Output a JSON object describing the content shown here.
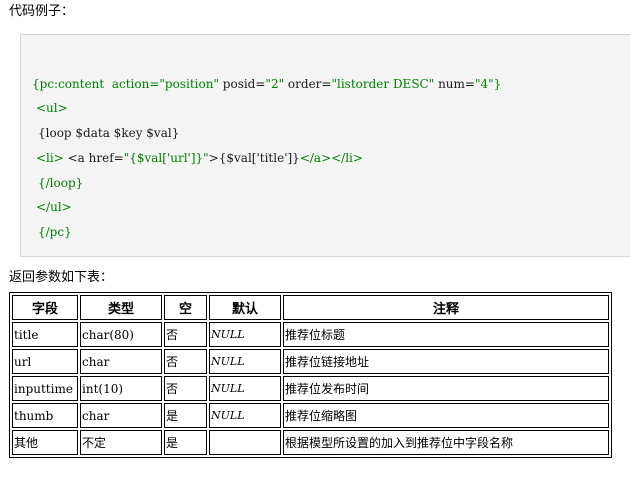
{
  "captions": {
    "example": "代码例子：",
    "params": "返回参数如下表："
  },
  "code": {
    "line1": {
      "a": "{pc:content  action=",
      "b": "\"position\"",
      "c": " posid=",
      "d": "\"2\"",
      "e": " order=",
      "f": "\"listorder DESC\"",
      "g": " num=",
      "h": "\"4\"",
      "i": "}"
    },
    "line2": "<ul>",
    "line3": "{loop $data $key $val}",
    "line4": {
      "a": "<li>",
      "b": " <a href=",
      "c": "\"{$val['url']}\"",
      "d": ">",
      "e": "{$val['title']}",
      "f": "</a></li>"
    },
    "line5": "{/loop}",
    "line6": "</ul>",
    "line7": "{/pc}"
  },
  "table": {
    "headers": [
      "字段",
      "类型",
      "空",
      "默认",
      "注释"
    ],
    "rows": [
      [
        "title",
        "char(80)",
        "否",
        "NULL",
        "推荐位标题"
      ],
      [
        "url",
        "char",
        "否",
        "NULL",
        "推荐位链接地址"
      ],
      [
        "inputtime",
        "int(10)",
        "否",
        "NULL",
        "推荐位发布时间"
      ],
      [
        "thumb",
        "char",
        "是",
        "NULL",
        "推荐位缩略图"
      ],
      [
        "其他",
        "不定",
        "是",
        "",
        "根据模型所设置的加入到推荐位中字段名称"
      ]
    ]
  },
  "colors": {
    "code_background": "#f4f4f4",
    "code_string": "#008000",
    "code_text": "#1a1a1a"
  }
}
